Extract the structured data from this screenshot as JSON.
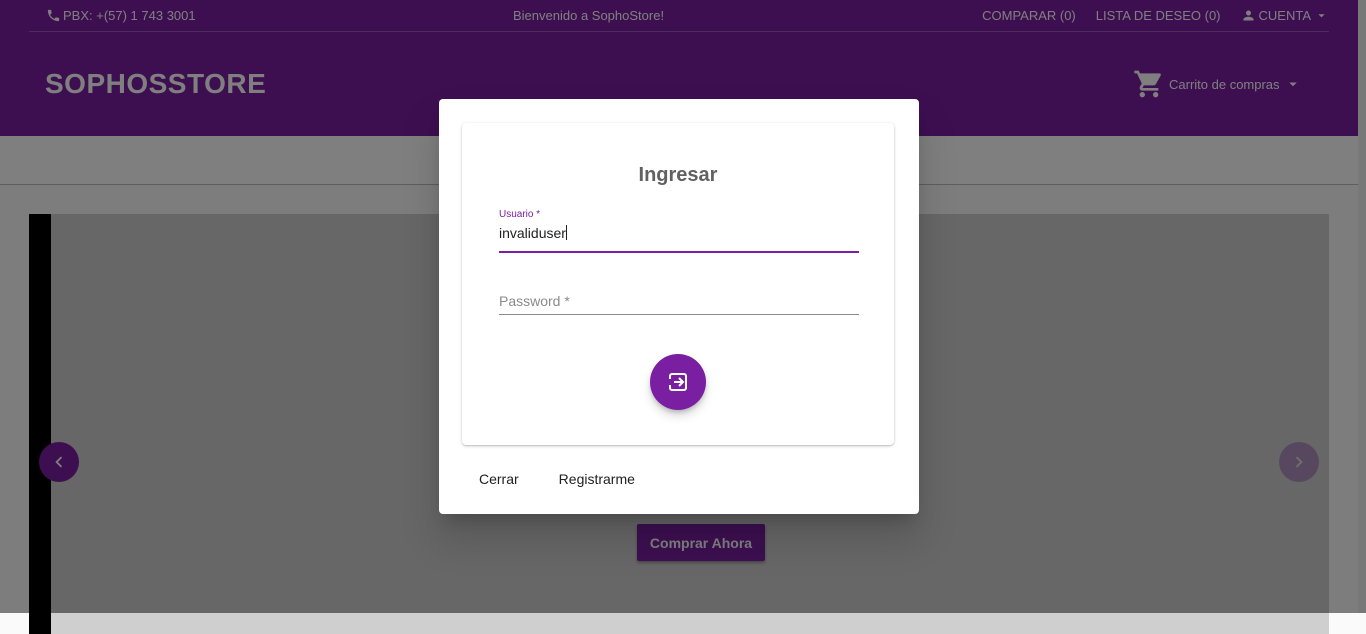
{
  "topbar": {
    "phone_icon": "phone-icon",
    "phone": "PBX: +(57) 1 743 3001",
    "welcome": "Bienvenido a SophoStore!",
    "compare": "COMPARAR (0)",
    "wishlist": "LISTA DE DESEO (0)",
    "account": "CUENTA",
    "account_icon": "person-icon"
  },
  "header": {
    "brand": "SOPHOSSTORE",
    "cart": "Carrito de compras",
    "cart_icon": "cart-icon"
  },
  "carousel": {
    "buy_label": "Comprar Ahora"
  },
  "dialog": {
    "title": "Ingresar",
    "username_label": "Usuario *",
    "username_value": "invaliduser",
    "password_placeholder": "Password *",
    "login_icon": "login-icon",
    "close_label": "Cerrar",
    "register_label": "Registrarme"
  },
  "colors": {
    "brand": "#7b1fa2",
    "overlay": "rgba(0,0,0,0.5)"
  }
}
